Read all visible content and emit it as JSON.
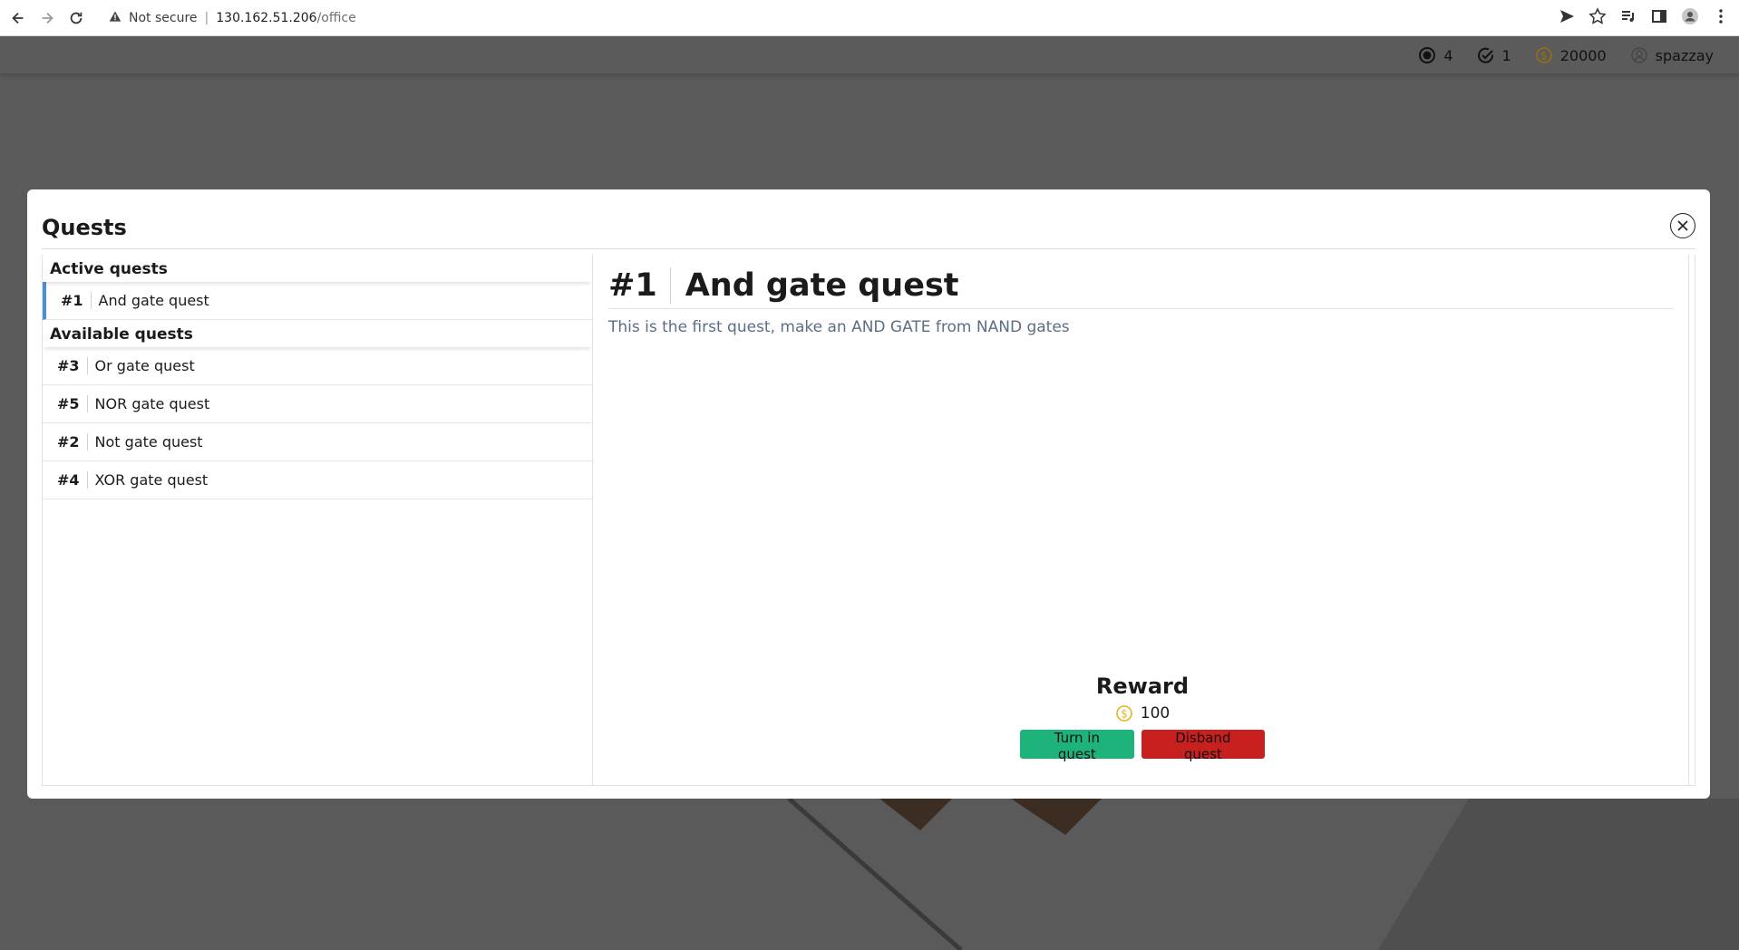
{
  "browser": {
    "security_label": "Not secure",
    "url_host": "130.162.51.206",
    "url_path": "/office"
  },
  "stats": {
    "tokens": "4",
    "completed": "1",
    "coins": "20000",
    "username": "spazzay"
  },
  "modal": {
    "title": "Quests"
  },
  "sections": {
    "active": "Active quests",
    "available": "Available quests"
  },
  "active_quests": [
    {
      "num": "#1",
      "name": "And gate quest"
    }
  ],
  "available_quests": [
    {
      "num": "#3",
      "name": "Or gate quest"
    },
    {
      "num": "#5",
      "name": "NOR gate quest"
    },
    {
      "num": "#2",
      "name": "Not gate quest"
    },
    {
      "num": "#4",
      "name": "XOR gate quest"
    }
  ],
  "detail": {
    "num": "#1",
    "title": "And gate quest",
    "description": "This is the first quest, make an AND GATE from NAND gates",
    "reward_label": "Reward",
    "reward_amount": "100",
    "turn_in_label": "Turn in quest",
    "disband_label": "Disband quest"
  },
  "colors": {
    "accent": "#4a90d9",
    "turn_in": "#1fb37c",
    "disband": "#c8201f",
    "coin": "#e6b422"
  }
}
